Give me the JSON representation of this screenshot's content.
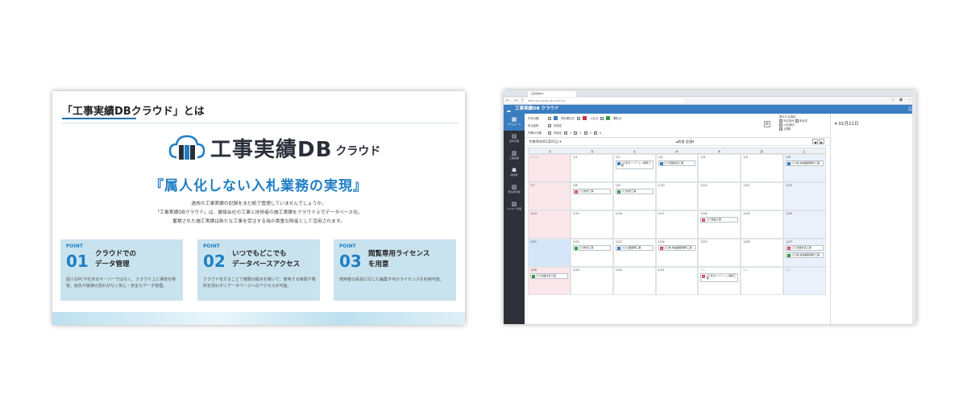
{
  "slide": {
    "heading": "「工事実績DBクラウド」とは",
    "logo_main": "工事実績DB",
    "logo_sub": "クラウド",
    "catchphrase": "『属人化しない入札業務の実現』",
    "desc_lines": [
      "過去の工事実績の記録をまだ紙で管理していませんでしょうか。",
      "「工事実績DBクラウド」は、建設会社の工事と技術者の施工実績をクラウド上でデータベース化。",
      "蓄積された施工実績は新たな工事を受注する為の貴重な財産として活用されます。"
    ],
    "points": [
      {
        "tag": "POINT",
        "num": "01",
        "title": "クラウドでの\nデータ管理",
        "desc": "個人のPCや社内のサーバーではなく、クラウド上に保管を移管。紛失や破損の恐れがなく安心・安全なデータ管理。"
      },
      {
        "tag": "POINT",
        "num": "02",
        "title": "いつでもどこでも\nデータベースアクセス",
        "desc": "クラウド化することで複数の拠点を跨いで、使用する時間や場所を問わずにデータベースへのアクセスが可能。"
      },
      {
        "tag": "POINT",
        "num": "03",
        "title": "閲覧専用ライセンス\nを用意",
        "desc": "使用者の役割に応じた編集不可のライセンスを利用可能。"
      }
    ]
  },
  "app": {
    "tab_title": "工事実績DB",
    "url": "https://koji.jisseki-db-cloud.net",
    "header_title": "工事実績DB クラウド",
    "sidebar": [
      {
        "label": "スケジュール",
        "icon": "calendar-icon",
        "glyph": "▦"
      },
      {
        "label": "案件管理",
        "icon": "folder-icon",
        "glyph": "▤"
      },
      {
        "label": "工事実績",
        "icon": "building-icon",
        "glyph": "▥"
      },
      {
        "label": "技術者",
        "icon": "person-icon",
        "glyph": "☗"
      },
      {
        "label": "発注者管理",
        "icon": "office-icon",
        "glyph": "▧"
      },
      {
        "label": "マスター管理",
        "icon": "database-icon",
        "glyph": "▨"
      }
    ],
    "filters": {
      "row1_label": "予定分類",
      "row1_items": [
        "資料提出日",
        "入札日",
        "開札日"
      ],
      "row2_label": "担当技術",
      "row2_items": [
        "未設定"
      ],
      "row3_label": "作業の分類",
      "row3_items": [
        "未設定",
        "1",
        "2",
        "3",
        "4"
      ],
      "display_title": "表示する項目",
      "display_items": [
        "対応済み",
        "未対応",
        "入札締切",
        "1週間"
      ]
    },
    "calendar": {
      "current": "令和06年01月01日 ▾",
      "sort": "▴前週  翌週▾",
      "dow": [
        "日",
        "月",
        "火",
        "水",
        "木",
        "金",
        "土"
      ],
      "weeks": [
        [
          {
            "d": "12/31",
            "dim": true,
            "ev": []
          },
          {
            "d": "1/1",
            "ev": []
          },
          {
            "d": "1/2",
            "ev": [
              {
                "c": "#3a7dc0",
                "t": "〇〇町オーバーレイ補修工事"
              }
            ]
          },
          {
            "d": "1/3",
            "ev": [
              {
                "c": "#3a7dc0",
                "t": "〇〇道路改良工事"
              }
            ]
          },
          {
            "d": "1/4",
            "ev": []
          },
          {
            "d": "1/5",
            "ev": []
          },
          {
            "d": "1/6",
            "ev": [
              {
                "c": "#3a7dc0",
                "t": "〇〇線 新設舗装補修工事"
              }
            ]
          }
        ],
        [
          {
            "d": "1/7",
            "ev": []
          },
          {
            "d": "1/8",
            "ev": [
              {
                "c": "#c8324a",
                "b": "入",
                "t": "〇〇改修工事"
              }
            ]
          },
          {
            "d": "1/9",
            "ev": [
              {
                "c": "#2f9b3a",
                "b": "✓",
                "t": "〇〇改修工事"
              }
            ]
          },
          {
            "d": "1/10",
            "ev": []
          },
          {
            "d": "1/11",
            "ev": []
          },
          {
            "d": "1/12",
            "ev": []
          },
          {
            "d": "1/13",
            "ev": []
          }
        ],
        [
          {
            "d": "1/14",
            "ev": []
          },
          {
            "d": "1/15",
            "ev": []
          },
          {
            "d": "1/16",
            "ev": []
          },
          {
            "d": "1/17",
            "ev": []
          },
          {
            "d": "1/18",
            "ev": [
              {
                "c": "#c8324a",
                "b": "入",
                "t": "〇〇架設工事"
              }
            ]
          },
          {
            "d": "1/19",
            "ev": []
          },
          {
            "d": "1/20",
            "ev": []
          }
        ],
        [
          {
            "d": "1/21",
            "today": true,
            "ev": []
          },
          {
            "d": "1/22",
            "ev": [
              {
                "c": "#2f9b3a",
                "t": "〇〇修繕工事"
              }
            ]
          },
          {
            "d": "1/23",
            "ev": [
              {
                "c": "#3a7dc0",
                "t": "〇〇公園整備工事"
              }
            ]
          },
          {
            "d": "1/24",
            "ev": [
              {
                "c": "#c8324a",
                "b": "入",
                "t": "〇〇線 新設舗装補修工事"
              }
            ]
          },
          {
            "d": "1/25",
            "ev": []
          },
          {
            "d": "1/26",
            "ev": []
          },
          {
            "d": "1/27",
            "ev": [
              {
                "c": "#c8324a",
                "b": "入",
                "t": "〇〇道路改良工事"
              },
              {
                "c": "#2f9b3a",
                "t": "〇〇線 新設舗装補修工事"
              }
            ]
          }
        ],
        [
          {
            "d": "1/28",
            "ev": [
              {
                "c": "#2f9b3a",
                "t": "〇〇道路改良工事"
              }
            ]
          },
          {
            "d": "1/29",
            "ev": []
          },
          {
            "d": "1/30",
            "ev": []
          },
          {
            "d": "1/31",
            "ev": []
          },
          {
            "d": "2/1",
            "dim": true,
            "ev": [
              {
                "c": "#c8324a",
                "b": "入",
                "t": "〇〇町オーバーレイ補修工事"
              }
            ]
          },
          {
            "d": "2/2",
            "dim": true,
            "ev": []
          },
          {
            "d": "2/3",
            "dim": true,
            "ev": []
          }
        ]
      ]
    },
    "right_panel_date": "01月21日"
  }
}
